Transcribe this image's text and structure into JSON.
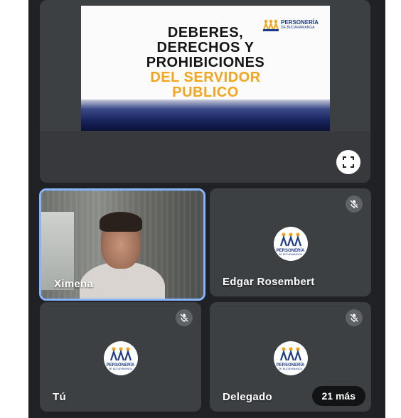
{
  "slide": {
    "title_black": [
      "DEBERES,",
      "DERECHOS Y",
      "PROHIBICIONES"
    ],
    "title_gold": [
      "DEL SERVIDOR",
      "PUBLICO"
    ],
    "logo_brand": "PERSONERÍA",
    "logo_sub": "DE BUCARAMANGA"
  },
  "colors": {
    "background": "#202124",
    "tile": "#3c4043",
    "active_border": "#8ab4f8",
    "gold": "#f5a51c",
    "brand_blue": "#1e3a8a"
  },
  "participants": [
    {
      "name": "Ximena",
      "muted": false,
      "video": true,
      "active_speaker": true
    },
    {
      "name": "Edgar Rosembert",
      "muted": true,
      "video": false,
      "avatar_text": "PERSONERÍA",
      "avatar_sub": "DE BUCARAMANGA"
    },
    {
      "name": "Tú",
      "muted": true,
      "video": false,
      "avatar_text": "PERSONERÍA",
      "avatar_sub": "DE BUCARAMANGA"
    },
    {
      "name": "Delegado",
      "muted": true,
      "video": false,
      "avatar_text": "PERSONERÍA",
      "avatar_sub": "DE BUCARAMANGA"
    }
  ],
  "overflow_label": "21 más",
  "icons": {
    "fullscreen": "fullscreen-icon",
    "mic_off": "mic-off-icon"
  }
}
